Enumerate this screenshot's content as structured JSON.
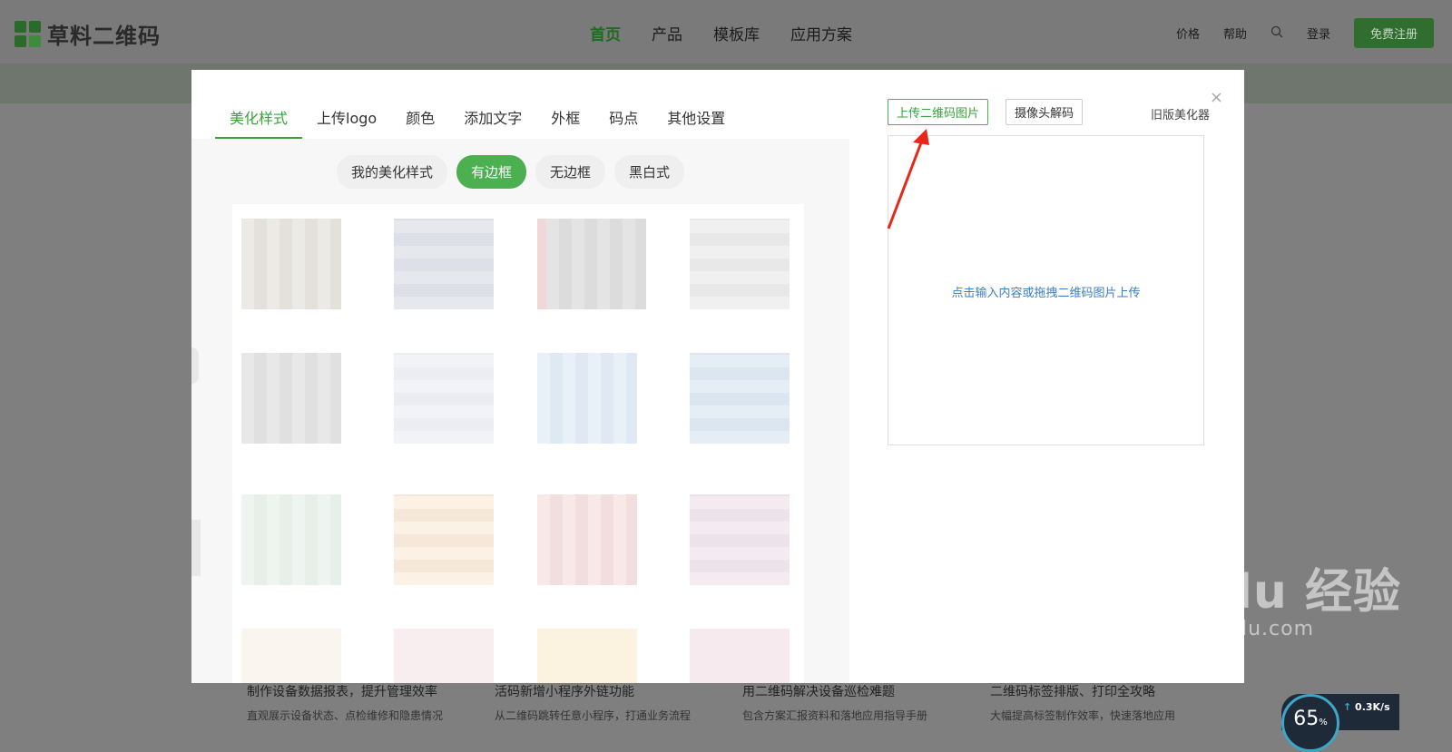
{
  "site": {
    "logo_text": "草料二维码",
    "nav": [
      "首页",
      "产品",
      "模板库",
      "应用方案"
    ],
    "right_nav": {
      "price": "价格",
      "help": "帮助",
      "login": "登录",
      "signup": "免费注册"
    },
    "bottom_cards": [
      {
        "title": "制作设备数据报表，提升管理效率",
        "desc": "直观展示设备状态、点检维修和隐患情况"
      },
      {
        "title": "活码新增小程序外链功能",
        "desc": "从二维码跳转任意小程序，打通业务流程"
      },
      {
        "title": "用二维码解决设备巡检难题",
        "desc": "包含方案汇报资料和落地应用指导手册"
      },
      {
        "title": "二维码标签排版、打印全攻略",
        "desc": "大幅提高标签制作效率，快速落地应用"
      }
    ]
  },
  "modal": {
    "close": "×",
    "tabs": [
      "美化样式",
      "上传logo",
      "颜色",
      "添加文字",
      "外框",
      "码点",
      "其他设置"
    ],
    "subtabs": [
      "我的美化样式",
      "有边框",
      "无边框",
      "黑白式"
    ],
    "upload_qr_button": "上传二维码图片",
    "camera_decode_button": "摄像头解码",
    "old_beautifier_link": "旧版美化器",
    "upload_hint": "点击输入内容或拖拽二维码图片上传"
  },
  "overlay": {
    "watermark_brand": "Bai du 经验",
    "watermark_url": "jingyan.baidu.com",
    "speed_percent": "65",
    "speed_rate": "0.3K/s"
  },
  "colors": {
    "accent": "#4caf50",
    "link": "#3a7fc1",
    "arrow": "#e8271a"
  }
}
